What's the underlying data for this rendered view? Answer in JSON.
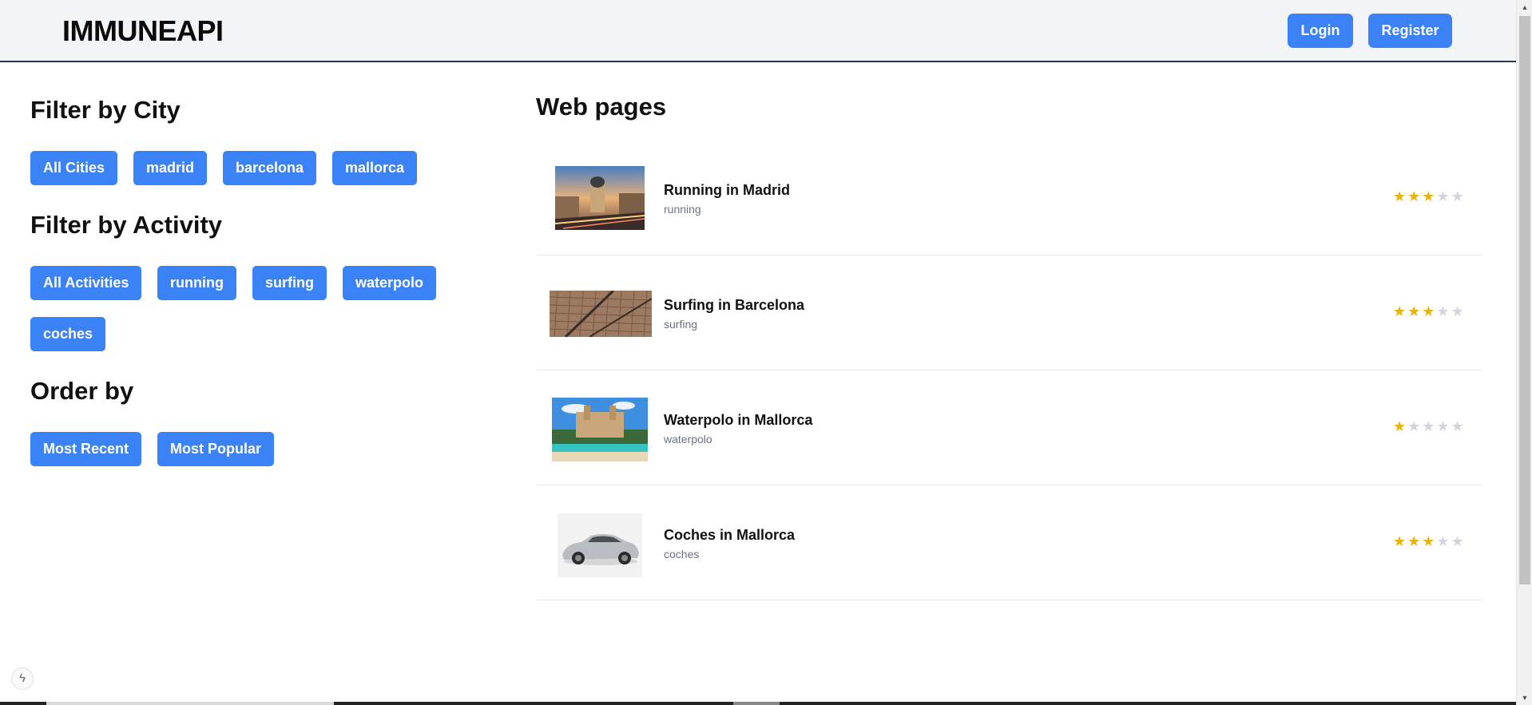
{
  "header": {
    "brand": "IMMUNEAPI",
    "login_label": "Login",
    "register_label": "Register"
  },
  "filters": {
    "city_title": "Filter by City",
    "cities": [
      "All Cities",
      "madrid",
      "barcelona",
      "mallorca"
    ],
    "activity_title": "Filter by Activity",
    "activities": [
      "All Activities",
      "running",
      "surfing",
      "waterpolo",
      "coches"
    ],
    "order_title": "Order by",
    "orders": [
      "Most Recent",
      "Most Popular"
    ]
  },
  "web_pages": {
    "title": "Web pages",
    "items": [
      {
        "title": "Running in Madrid",
        "activity": "running",
        "rating": 3,
        "max_rating": 5
      },
      {
        "title": "Surfing in Barcelona",
        "activity": "surfing",
        "rating": 3,
        "max_rating": 5
      },
      {
        "title": "Waterpolo in Mallorca",
        "activity": "waterpolo",
        "rating": 1,
        "max_rating": 5
      },
      {
        "title": "Coches in Mallorca",
        "activity": "coches",
        "rating": 3,
        "max_rating": 5
      }
    ]
  },
  "colors": {
    "primary": "#3b82f6",
    "star_active": "#eab308",
    "star_inactive": "#d1d5db",
    "header_bg": "#f3f4f6"
  },
  "icons": {
    "star": "★",
    "floating_button": "bolt-icon"
  }
}
